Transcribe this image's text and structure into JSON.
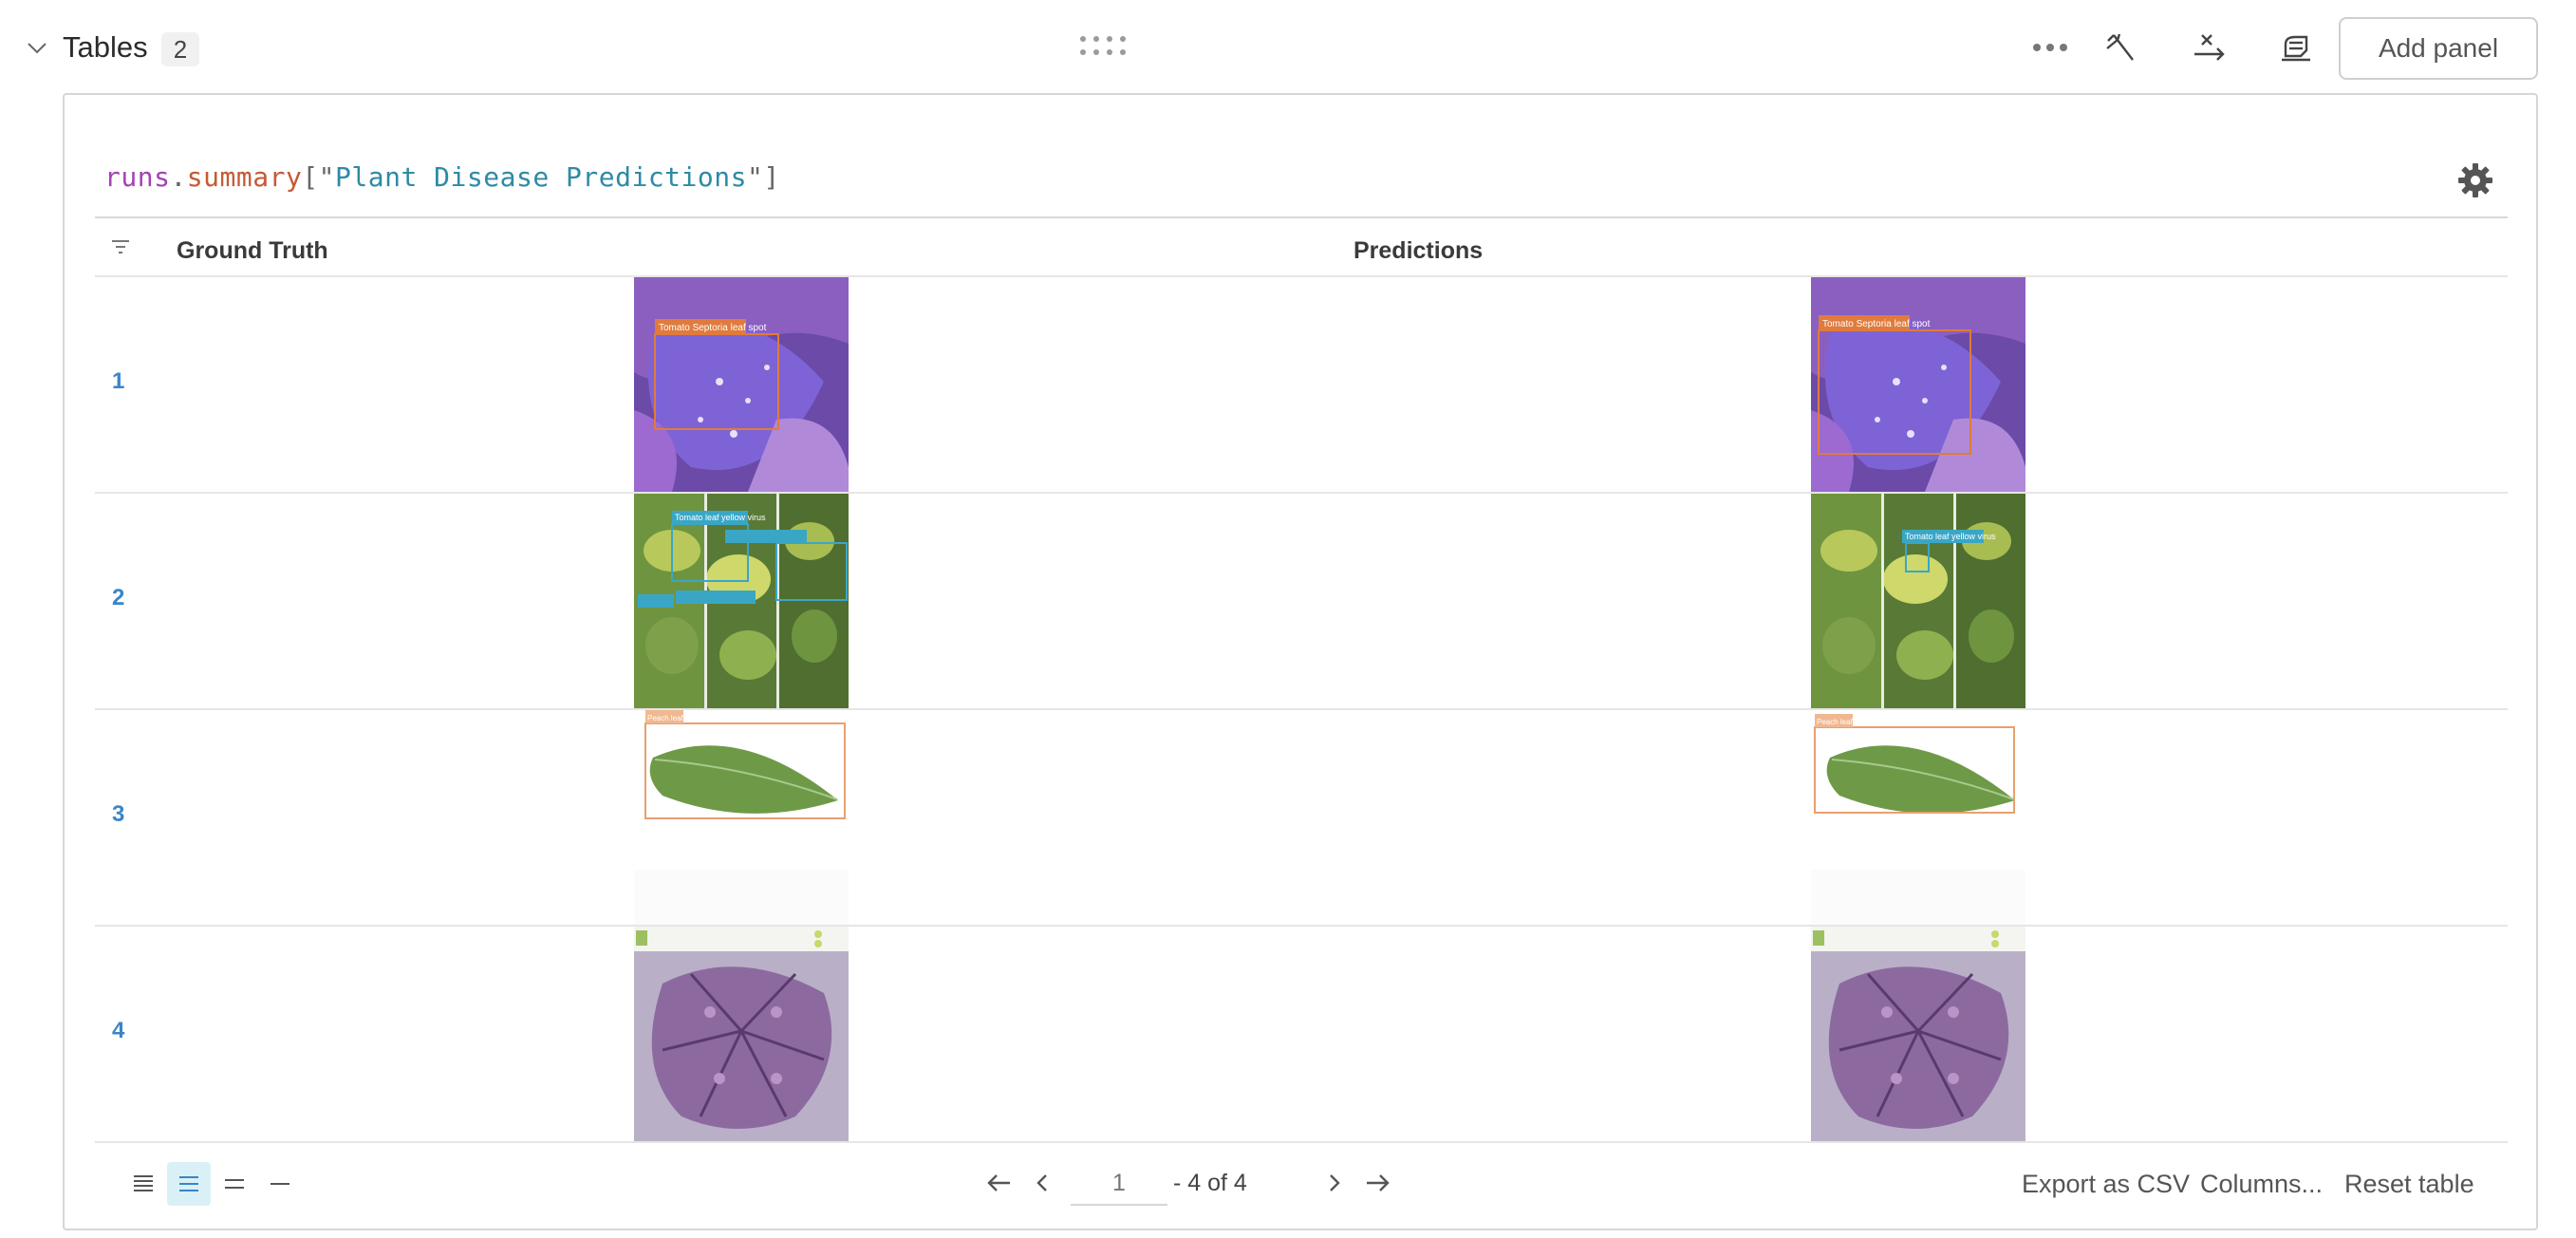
{
  "section": {
    "title": "Tables",
    "count": "2",
    "add_panel_label": "Add panel",
    "icons": [
      "chevron-down-icon",
      "drag-handle-icon",
      "more-icon",
      "magic-wand-icon",
      "x-axis-icon",
      "eraser-icon"
    ]
  },
  "panel": {
    "expression": {
      "runs": "runs",
      "dot": ".",
      "summary": "summary",
      "open": "[\"",
      "key": "Plant Disease Predictions",
      "close": "\"]"
    }
  },
  "table": {
    "columns": [
      "Ground Truth",
      "Predictions"
    ],
    "rows": [
      {
        "index": "1",
        "gt_image": "Tomato Septoria leaf spot image",
        "gt_label": "Tomato Septoria leaf spot",
        "pred_image": "Tomato Septoria leaf spot image",
        "pred_label": "Tomato Septoria leaf spot"
      },
      {
        "index": "2",
        "gt_image": "Tomato leaf yellow virus image",
        "gt_label": "Tomato leaf yellow virus",
        "pred_image": "Tomato leaf yellow virus image",
        "pred_label": "Tomato leaf yellow virus"
      },
      {
        "index": "3",
        "gt_image": "Peach leaf image",
        "gt_label": "Peach leaf",
        "pred_image": "Peach leaf image",
        "pred_label": "Peach leaf"
      },
      {
        "index": "4",
        "gt_image": "Leaf image",
        "gt_label": "",
        "pred_image": "Leaf image",
        "pred_label": ""
      }
    ]
  },
  "footer": {
    "page_value": "1",
    "page_of": "- 4 of 4",
    "export_csv": "Export as CSV",
    "columns": "Columns...",
    "reset": "Reset table"
  },
  "colors": {
    "accent": "#3a85c8",
    "active_bg": "#d9f0f6",
    "expr_runs": "#a541b5",
    "expr_summary": "#c65a35",
    "expr_string": "#2e8aa6"
  }
}
